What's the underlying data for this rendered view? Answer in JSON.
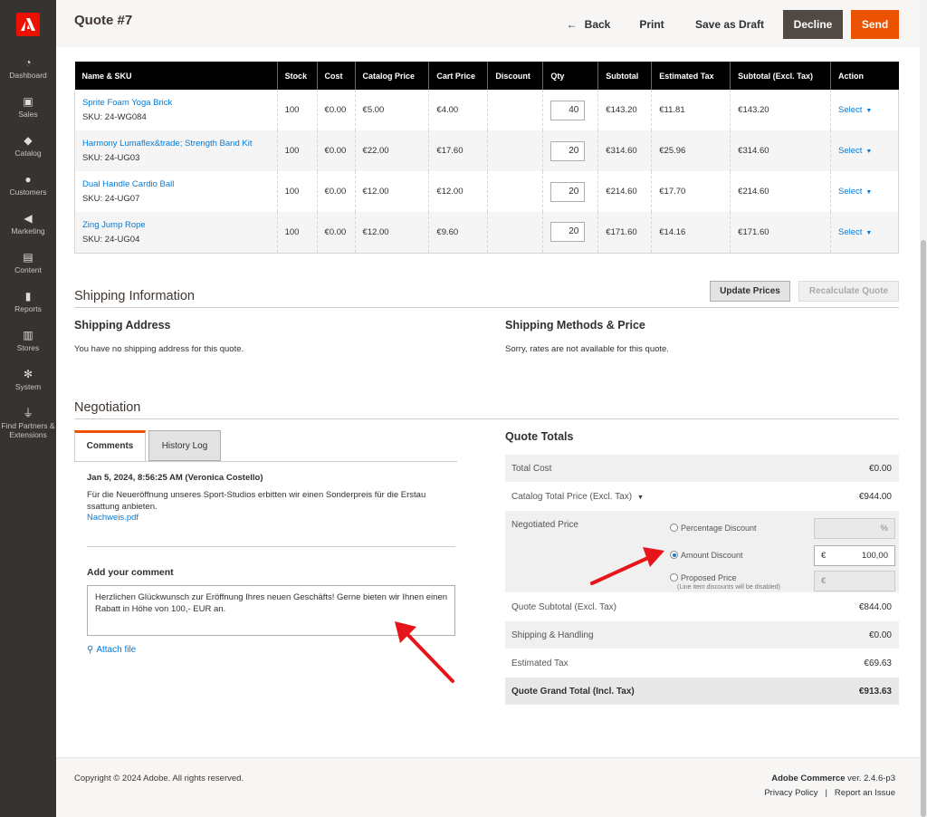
{
  "sidebar": {
    "items": [
      {
        "label": "Dashboard",
        "icon": "dashboard-icon"
      },
      {
        "label": "Sales",
        "icon": "dollar-icon"
      },
      {
        "label": "Catalog",
        "icon": "box-icon"
      },
      {
        "label": "Customers",
        "icon": "customers-icon"
      },
      {
        "label": "Marketing",
        "icon": "megaphone-icon"
      },
      {
        "label": "Content",
        "icon": "content-icon"
      },
      {
        "label": "Reports",
        "icon": "bar-chart-icon"
      },
      {
        "label": "Stores",
        "icon": "store-icon"
      },
      {
        "label": "System",
        "icon": "gear-icon"
      },
      {
        "label": "Find Partners & Extensions",
        "icon": "plug-icon"
      }
    ]
  },
  "header": {
    "title": "Quote #7",
    "back": "Back",
    "print": "Print",
    "save_draft": "Save as Draft",
    "decline": "Decline",
    "send": "Send",
    "accent": "#eb5202"
  },
  "items_table": {
    "columns": [
      "Name & SKU",
      "Stock",
      "Cost",
      "Catalog Price",
      "Cart Price",
      "Discount",
      "Qty",
      "Subtotal",
      "Estimated Tax",
      "Subtotal (Excl. Tax)",
      "Action"
    ],
    "rows": [
      {
        "name": "Sprite Foam Yoga Brick",
        "sku": "SKU: 24-WG084",
        "stock": "100",
        "cost": "€0.00",
        "catalog": "€5.00",
        "cart": "€4.00",
        "discount": "",
        "qty": "40",
        "subtotal": "€143.20",
        "tax": "€11.81",
        "subtotal_excl": "€143.20",
        "action": "Select"
      },
      {
        "name": "Harmony Lumaflex&trade; Strength Band Kit",
        "sku": "SKU: 24-UG03",
        "stock": "100",
        "cost": "€0.00",
        "catalog": "€22.00",
        "cart": "€17.60",
        "discount": "",
        "qty": "20",
        "subtotal": "€314.60",
        "tax": "€25.96",
        "subtotal_excl": "€314.60",
        "action": "Select"
      },
      {
        "name": "Dual Handle Cardio Ball",
        "sku": "SKU: 24-UG07",
        "stock": "100",
        "cost": "€0.00",
        "catalog": "€12.00",
        "cart": "€12.00",
        "discount": "",
        "qty": "20",
        "subtotal": "€214.60",
        "tax": "€17.70",
        "subtotal_excl": "€214.60",
        "action": "Select"
      },
      {
        "name": "Zing Jump Rope",
        "sku": "SKU: 24-UG04",
        "stock": "100",
        "cost": "€0.00",
        "catalog": "€12.00",
        "cart": "€9.60",
        "discount": "",
        "qty": "20",
        "subtotal": "€171.60",
        "tax": "€14.16",
        "subtotal_excl": "€171.60",
        "action": "Select"
      }
    ]
  },
  "shipping": {
    "title": "Shipping Information",
    "update_prices": "Update Prices",
    "recalculate": "Recalculate Quote",
    "address_title": "Shipping Address",
    "address_text": "You have no shipping address for this quote.",
    "methods_title": "Shipping Methods & Price",
    "methods_text": "Sorry, rates are not available for this quote."
  },
  "negotiation": {
    "title": "Negotiation",
    "tab_comments": "Comments",
    "tab_history": "History Log",
    "comment_meta": "Jan 5, 2024, 8:56:25 AM (Veronica Costello)",
    "comment_text": "Für die Neueröffnung unseres Sport-Studios erbitten wir einen Sonderpreis für die Erstau ssattung anbieten.",
    "attachment": "Nachweis.pdf",
    "add_comment_label": "Add your comment",
    "comment_input": "Herzlichen Glückwunsch zur Eröffnung Ihres neuen Geschäfts! Gerne bieten wir Ihnen einen Rabatt in Höhe von 100,- EUR an.",
    "attach_file": "Attach file"
  },
  "totals": {
    "title": "Quote Totals",
    "total_cost_label": "Total Cost",
    "total_cost": "€0.00",
    "catalog_total_label": "Catalog Total Price (Excl. Tax)",
    "catalog_total": "€944.00",
    "negotiated_label": "Negotiated Price",
    "pct_label": "Percentage Discount",
    "pct_symbol": "%",
    "amount_label": "Amount Discount",
    "amount_symbol": "€",
    "amount_value": "100,00",
    "proposed_label": "Proposed Price",
    "proposed_note": "(Line item discounts will be disabled)",
    "proposed_symbol": "€",
    "subtotal_label": "Quote Subtotal (Excl. Tax)",
    "subtotal": "€844.00",
    "shipping_label": "Shipping & Handling",
    "shipping": "€0.00",
    "tax_label": "Estimated Tax",
    "tax": "€69.63",
    "grand_label": "Quote Grand Total (Incl. Tax)",
    "grand": "€913.63"
  },
  "footer": {
    "copyright": "Copyright © 2024 Adobe. All rights reserved.",
    "brand": "Adobe Commerce",
    "version": " ver. 2.4.6-p3",
    "privacy": "Privacy Policy",
    "separator": "|",
    "report": "Report an Issue"
  },
  "annotation_color": "#e8141b"
}
